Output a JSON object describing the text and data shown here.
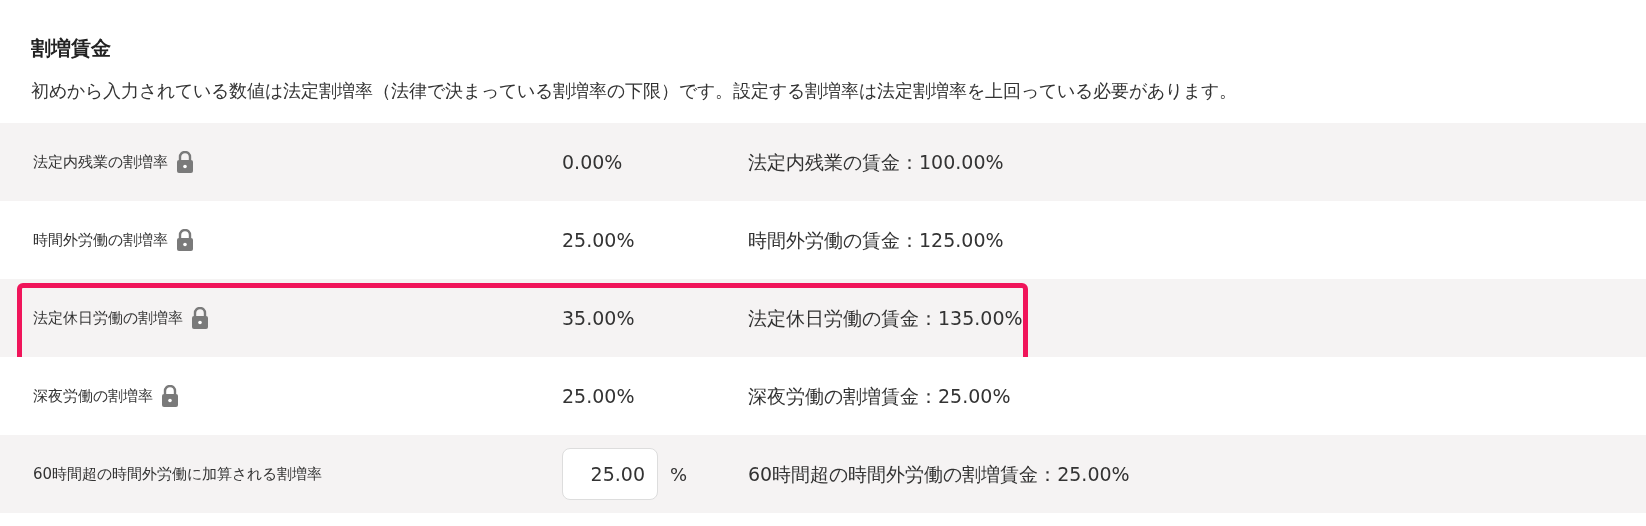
{
  "section": {
    "title": "割増賃金",
    "description": "初めから入力されている数値は法定割増率（法律で決まっている割増率の下限）です。設定する割増率は法定割増率を上回っている必要があります。"
  },
  "rows": [
    {
      "kind": "locked",
      "label": "法定内残業の割増率",
      "value": "0.00%",
      "wage": "法定内残業の賃金：100.00%",
      "highlighted": false
    },
    {
      "kind": "locked",
      "label": "時間外労働の割増率",
      "value": "25.00%",
      "wage": "時間外労働の賃金：125.00%",
      "highlighted": false
    },
    {
      "kind": "locked",
      "label": "法定休日労働の割増率",
      "value": "35.00%",
      "wage": "法定休日労働の賃金：135.00%",
      "highlighted": true
    },
    {
      "kind": "locked",
      "label": "深夜労働の割増率",
      "value": "25.00%",
      "wage": "深夜労働の割増賃金：25.00%",
      "highlighted": false
    },
    {
      "kind": "input",
      "label": "60時間超の時間外労働に加算される割増率",
      "value": "25.00",
      "unit": "%",
      "wage": "60時間超の時間外労働の割増賃金：25.00%",
      "highlighted": false
    }
  ]
}
